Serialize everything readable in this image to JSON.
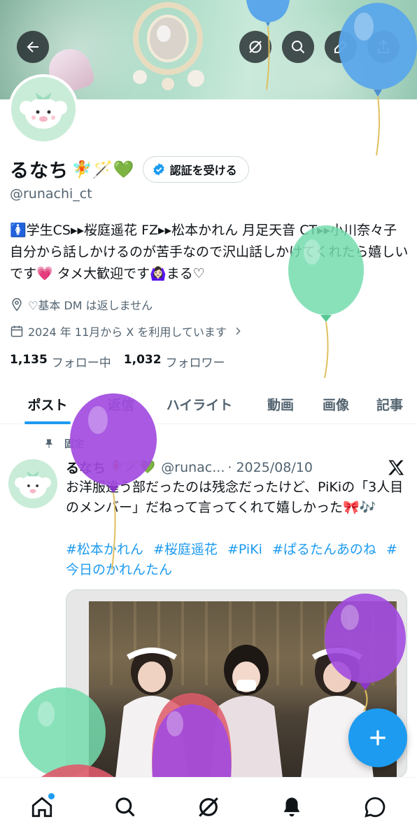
{
  "header": {
    "back_icon": "arrow-left-icon",
    "grok_icon": "grok-icon",
    "search_icon": "search-icon",
    "edit_icon": "pen-icon",
    "share_icon": "share-icon"
  },
  "profile": {
    "name": "るなち",
    "name_emojis": "🧚🪄💚",
    "verify_label": "認証を受ける",
    "handle": "@runachi_ct",
    "bio": "🚺学生CS▸▸桜庭遥花 FZ▸▸松本かれん 月足天音 CT▸▸小川奈々子 自分から話しかけるのが苦手なので沢山話しかけてくれたら嬉しいです💗 タメ大歓迎です🙆🏻‍♀️まる♡",
    "location": "♡基本 DM は返しません",
    "joined": "2024 年 11月から X を利用しています",
    "following_count": "1,135",
    "following_label": "フォロー中",
    "followers_count": "1,032",
    "followers_label": "フォロワー"
  },
  "tabs": [
    {
      "label": "ポスト"
    },
    {
      "label": "返信"
    },
    {
      "label": "ハイライト"
    },
    {
      "label": "動画"
    },
    {
      "label": "画像"
    },
    {
      "label": "記事"
    }
  ],
  "post": {
    "pinned_label": "固定",
    "author_name": "るなち",
    "author_emojis": "🧚🪄💚",
    "author_handle": "@runac...",
    "date": "· 2025/08/10",
    "text": "お洋服違う部だったのは残念だったけど、PiKiの「3人目のメンバー」だねって言ってくれて嬉しかった🎀🎶",
    "hashtags": [
      "#松本かれん",
      "#桜庭遥花",
      "#PiKi",
      "#ぱるたんあのね",
      "#今日のかれんたん"
    ]
  },
  "bottom_nav": [
    {
      "icon": "home-icon"
    },
    {
      "icon": "search-icon"
    },
    {
      "icon": "grok-icon"
    },
    {
      "icon": "bell-icon"
    },
    {
      "icon": "message-icon"
    }
  ],
  "colors": {
    "accent": "#1d9bf0",
    "text": "#0f1419",
    "muted": "#536471",
    "balloon_blue": "#5ba7ea",
    "balloon_green": "#74dcae",
    "balloon_purple": "#a24be0",
    "balloon_red": "#de5b6a"
  }
}
